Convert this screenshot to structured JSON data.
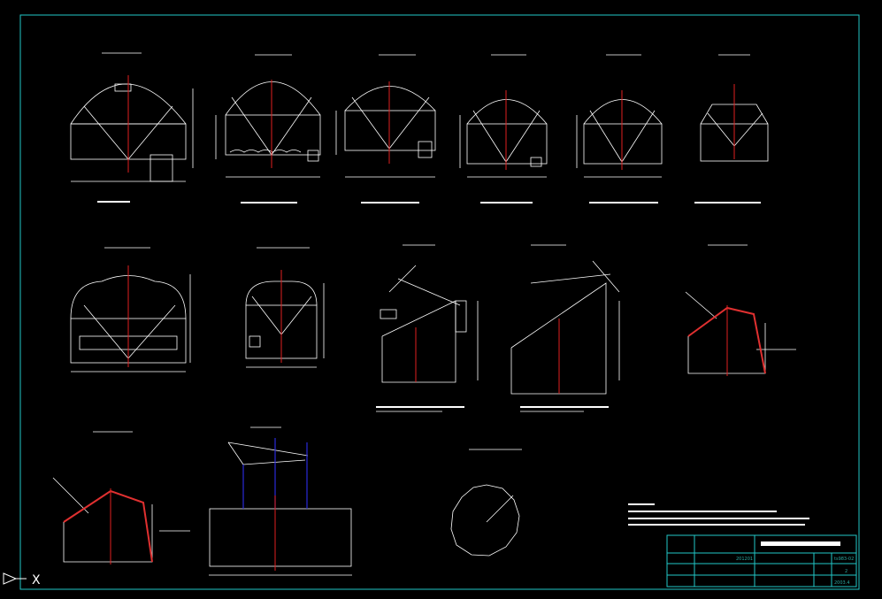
{
  "drawing": {
    "title_block": {
      "drawing_no": "ts983-02",
      "revision": "201201",
      "sheet": "2",
      "date": "2003.4"
    }
  },
  "colors": {
    "background": "#000000",
    "lines": "#ffffff",
    "frame": "#22c7c7",
    "centerline": "#e02020",
    "blue": "#2a2ad8",
    "accent": "#e03030"
  },
  "icons": {
    "ucs": "ucs-arrow-icon",
    "x_axis": "x-axis-icon"
  },
  "cursor": {
    "axis_label": "X"
  }
}
